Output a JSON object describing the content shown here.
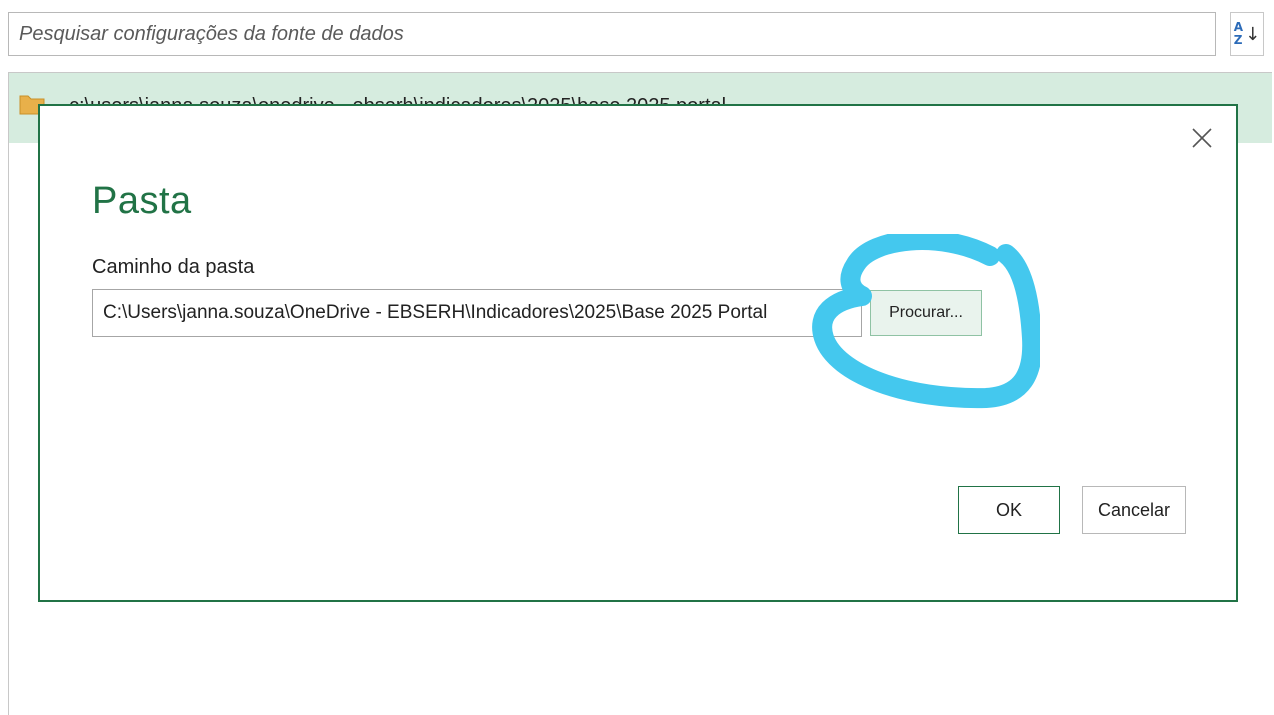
{
  "search": {
    "placeholder": "Pesquisar configurações da fonte de dados"
  },
  "sort_button": {
    "icon": "sort-az-icon",
    "letter_top": "A",
    "letter_bottom": "Z",
    "arrow": "↓"
  },
  "settings_list": {
    "selected_item": {
      "icon": "folder-icon",
      "text": "c:\\users\\janna.souza\\onedrive - ebserh\\indicadores\\2025\\base 2025 portal"
    }
  },
  "dialog": {
    "title": "Pasta",
    "close_icon": "close-icon",
    "field_label": "Caminho da pasta",
    "path_value": "C:\\Users\\janna.souza\\OneDrive - EBSERH\\Indicadores\\2025\\Base 2025 Portal",
    "browse_label": "Procurar...",
    "ok_label": "OK",
    "cancel_label": "Cancelar"
  },
  "colors": {
    "accent_green": "#217346",
    "selected_row": "#d6ecdf",
    "annotation_blue": "#44c8ee"
  }
}
